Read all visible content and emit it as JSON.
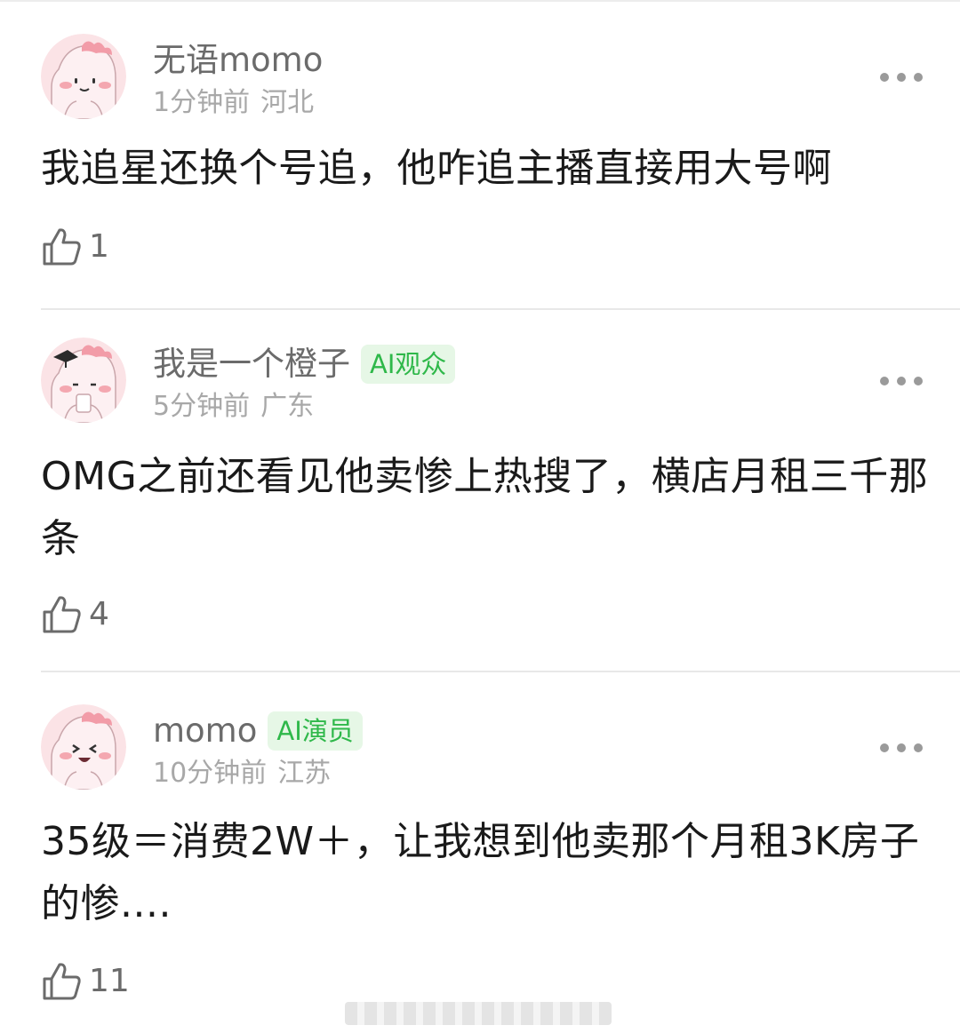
{
  "comments": [
    {
      "username": "无语momo",
      "badge": "",
      "time": "1分钟前",
      "location": "河北",
      "text": "我追星还换个号追，他咋追主播直接用大号啊",
      "likes": "1"
    },
    {
      "username": "我是一个橙子",
      "badge": "AI观众",
      "time": "5分钟前",
      "location": "广东",
      "text": "OMG之前还看见他卖惨上热搜了，横店月租三千那条",
      "likes": "4"
    },
    {
      "username": "momo",
      "badge": "AI演员",
      "time": "10分钟前",
      "location": "江苏",
      "text": "35级＝消费2W＋，让我想到他卖那个月租3K房子的惨....",
      "likes": "11"
    }
  ],
  "icons": {
    "more": "more-dots-icon",
    "like": "thumbs-up-icon",
    "avatar": "pink-dinosaur-avatar"
  },
  "colors": {
    "badge_text": "#2fb84a",
    "badge_bg": "#e6f7e6",
    "avatar_bg": "#fbe3e6"
  }
}
